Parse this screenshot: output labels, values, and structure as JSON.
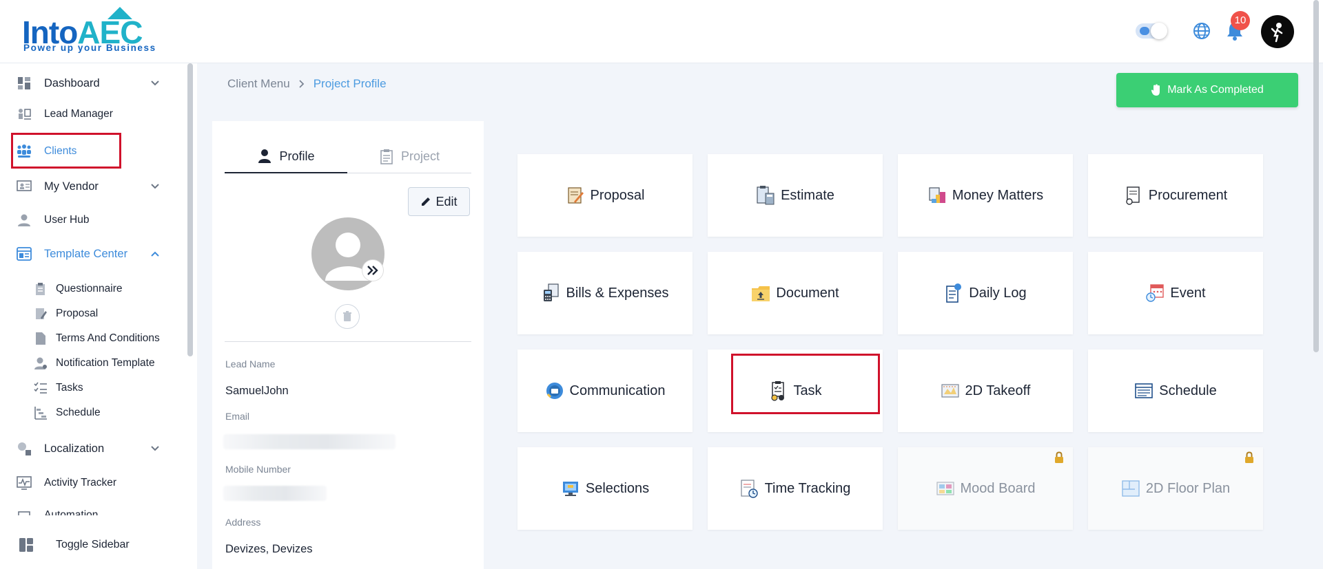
{
  "header": {
    "logo_text_a": "Into",
    "logo_text_b": "AEC",
    "logo_tagline": "Power up your Business",
    "notification_count": "10",
    "theme_toggle": "on"
  },
  "sidebar": {
    "items": [
      {
        "label": "Dashboard",
        "icon": "dashboard-icon",
        "has_chevron": true
      },
      {
        "label": "Lead Manager",
        "icon": "lead-manager-icon"
      },
      {
        "label": "Clients",
        "icon": "clients-icon",
        "active": true
      },
      {
        "label": "My Vendor",
        "icon": "vendor-icon",
        "has_chevron": true
      },
      {
        "label": "User Hub",
        "icon": "user-icon"
      },
      {
        "label": "Template Center",
        "icon": "template-icon",
        "expanded": true
      },
      {
        "label": "Questionnaire",
        "icon": "questionnaire-icon"
      },
      {
        "label": "Proposal",
        "icon": "proposal-icon"
      },
      {
        "label": "Terms And Conditions",
        "icon": "document-icon"
      },
      {
        "label": "Notification Template",
        "icon": "notification-template-icon"
      },
      {
        "label": "Tasks",
        "icon": "tasks-icon"
      },
      {
        "label": "Schedule",
        "icon": "schedule-icon"
      },
      {
        "label": "Localization",
        "icon": "localization-icon",
        "has_chevron": true
      },
      {
        "label": "Activity Tracker",
        "icon": "activity-icon"
      },
      {
        "label": "Automation",
        "icon": "automation-icon"
      }
    ],
    "toggle_label": "Toggle Sidebar"
  },
  "breadcrumb": {
    "parent": "Client Menu",
    "current": "Project Profile"
  },
  "actions": {
    "mark_completed": "Mark As Completed"
  },
  "profile": {
    "tabs": [
      "Profile",
      "Project"
    ],
    "edit_label": "Edit",
    "fields": [
      {
        "label": "Lead Name",
        "value": "SamuelJohn"
      },
      {
        "label": "Email",
        "value": ""
      },
      {
        "label": "Mobile Number",
        "value": ""
      },
      {
        "label": "Address",
        "value": "Devizes, Devizes"
      }
    ]
  },
  "modules": [
    {
      "label": "Proposal",
      "icon": "proposal-icon",
      "locked": false
    },
    {
      "label": "Estimate",
      "icon": "estimate-icon",
      "locked": false
    },
    {
      "label": "Money Matters",
      "icon": "money-icon",
      "locked": false
    },
    {
      "label": "Procurement",
      "icon": "procurement-icon",
      "locked": false
    },
    {
      "label": "Bills & Expenses",
      "icon": "bills-icon",
      "locked": false
    },
    {
      "label": "Document",
      "icon": "folder-icon",
      "locked": false
    },
    {
      "label": "Daily Log",
      "icon": "daily-log-icon",
      "locked": false
    },
    {
      "label": "Event",
      "icon": "calendar-icon",
      "locked": false
    },
    {
      "label": "Communication",
      "icon": "communication-icon",
      "locked": false
    },
    {
      "label": "Task",
      "icon": "task-icon",
      "locked": false,
      "highlighted": true
    },
    {
      "label": "2D Takeoff",
      "icon": "takeoff-icon",
      "locked": false
    },
    {
      "label": "Schedule",
      "icon": "schedule-icon",
      "locked": false
    },
    {
      "label": "Selections",
      "icon": "selections-icon",
      "locked": false
    },
    {
      "label": "Time Tracking",
      "icon": "time-tracking-icon",
      "locked": false
    },
    {
      "label": "Mood Board",
      "icon": "mood-board-icon",
      "locked": true
    },
    {
      "label": "2D Floor Plan",
      "icon": "floor-plan-icon",
      "locked": true
    }
  ],
  "colors": {
    "accent": "#3d8bdb",
    "success": "#3bcf74",
    "highlight": "#d0112b",
    "badge": "#f0524a"
  }
}
